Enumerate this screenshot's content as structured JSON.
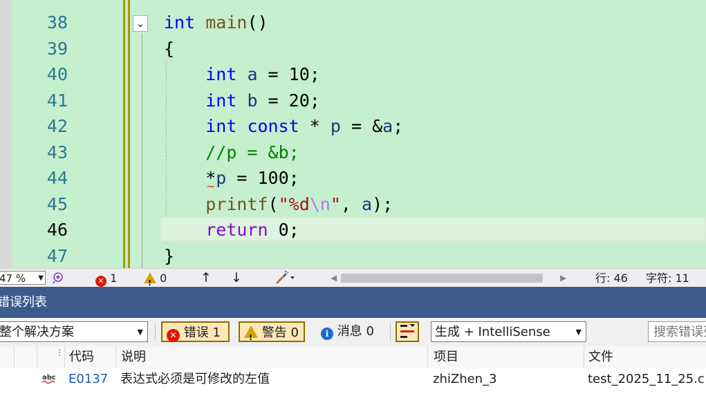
{
  "editor": {
    "lines": [
      {
        "num": "38"
      },
      {
        "num": "39"
      },
      {
        "num": "40"
      },
      {
        "num": "41"
      },
      {
        "num": "42"
      },
      {
        "num": "43"
      },
      {
        "num": "44"
      },
      {
        "num": "45"
      },
      {
        "num": "46"
      },
      {
        "num": "47"
      }
    ],
    "current_line": "46"
  },
  "statusbar": {
    "zoom": "47 %",
    "error_count": "1",
    "warning_count": "0",
    "line_label": "行: 46",
    "char_label": "字符: 11"
  },
  "error_list": {
    "title": "错误列表",
    "scope": "整个解决方案",
    "errors_label": "错误 1",
    "warnings_label": "警告 0",
    "messages_label": "消息 0",
    "build_filter": "生成 + IntelliSense",
    "search_placeholder": "搜索错误列表",
    "columns": {
      "code": "代码",
      "description": "说明",
      "project": "项目",
      "file": "文件"
    },
    "rows": [
      {
        "code": "E0137",
        "description": "表达式必须是可修改的左值",
        "project": "zhiZhen_3",
        "file": "test_2025_11_25.c"
      }
    ]
  },
  "colors": {
    "editor_bg": "#c6efce",
    "title_bar": "#3c5a8c",
    "keyword": "#0000ff",
    "error": "#e51400",
    "warning": "#d8a400"
  }
}
